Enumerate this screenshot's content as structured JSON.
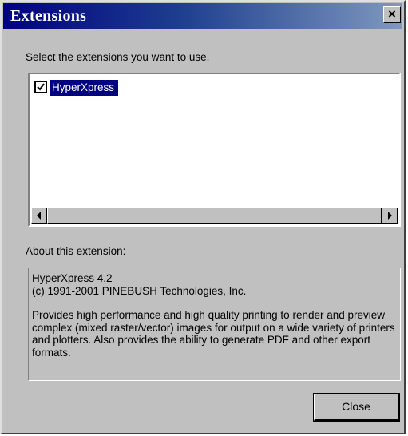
{
  "window": {
    "title": "Extensions"
  },
  "titlebar": {
    "close_glyph": "×",
    "close_icon": "close-icon"
  },
  "prompt": "Select the extensions you want to use.",
  "extensions": [
    {
      "label": "HyperXpress",
      "checked": true,
      "selected": true
    }
  ],
  "about": {
    "heading": "About this extension:",
    "line1": "HyperXpress 4.2",
    "line2": "(c) 1991-2001 PINEBUSH Technologies, Inc.",
    "description": "Provides high performance and high quality printing to render and preview complex (mixed raster/vector) images for output on a wide variety of printers and plotters.  Also provides the ability to generate PDF and other export formats."
  },
  "buttons": {
    "close": "Close"
  },
  "colors": {
    "titlebar_start": "#000080",
    "selection": "#000080",
    "face": "#c0c0c0"
  }
}
